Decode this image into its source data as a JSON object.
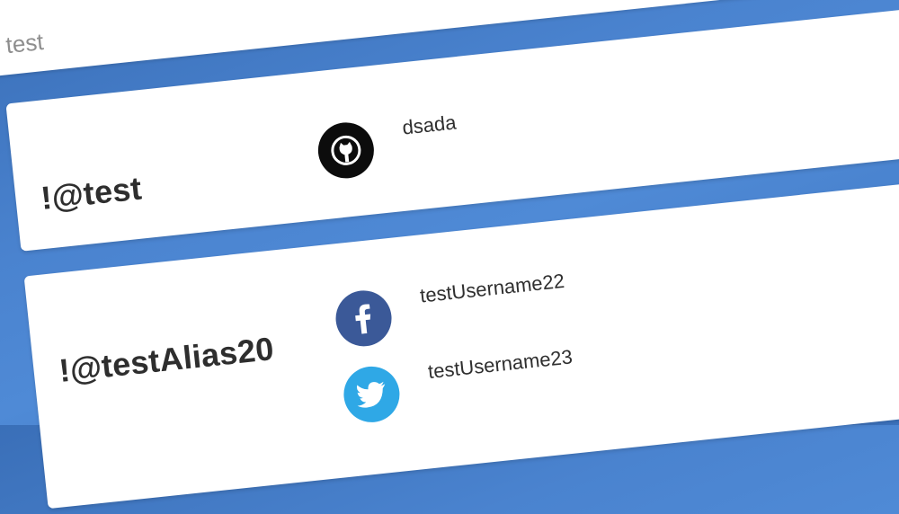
{
  "search": {
    "value": "test"
  },
  "aliases": [
    {
      "name": "!@test",
      "accounts": [
        {
          "icon": "github-icon",
          "username": "dsada"
        }
      ]
    },
    {
      "name": "!@testAlias20",
      "accounts": [
        {
          "icon": "facebook-icon",
          "username": "testUsername22"
        },
        {
          "icon": "twitter-icon",
          "username": "testUsername23"
        }
      ]
    }
  ],
  "colors": {
    "background": "#4a83cf",
    "github": "#0c0c0c",
    "facebook": "#3b5998",
    "twitter": "#2fa8e6",
    "text": "#2e2e2e"
  }
}
